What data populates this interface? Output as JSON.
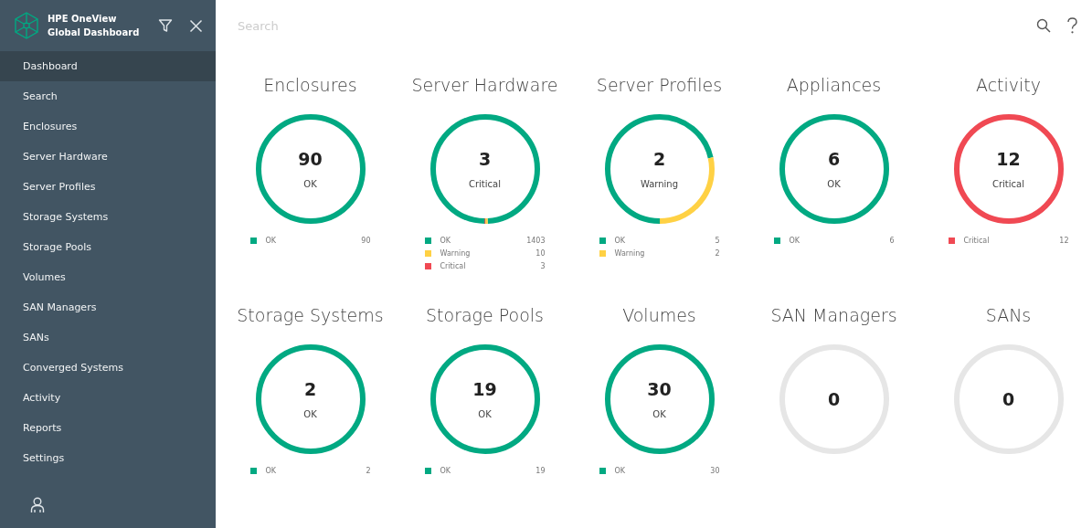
{
  "app": {
    "title_line1": "HPE OneView",
    "title_line2": "Global Dashboard"
  },
  "sidebar": {
    "items": [
      {
        "label": "Dashboard",
        "selected": true
      },
      {
        "label": "Search",
        "selected": false
      },
      {
        "label": "Enclosures",
        "selected": false
      },
      {
        "label": "Server Hardware",
        "selected": false
      },
      {
        "label": "Server Profiles",
        "selected": false
      },
      {
        "label": "Storage Systems",
        "selected": false
      },
      {
        "label": "Storage Pools",
        "selected": false
      },
      {
        "label": "Volumes",
        "selected": false
      },
      {
        "label": "SAN Managers",
        "selected": false
      },
      {
        "label": "SANs",
        "selected": false
      },
      {
        "label": "Converged Systems",
        "selected": false
      },
      {
        "label": "Activity",
        "selected": false
      },
      {
        "label": "Reports",
        "selected": false
      },
      {
        "label": "Settings",
        "selected": false
      }
    ]
  },
  "search": {
    "placeholder": "Search"
  },
  "tiles": [
    {
      "title": "Enclosures",
      "count": "90",
      "status": "OK",
      "legend": [
        {
          "label": "OK",
          "value": "90",
          "color": "#01a982"
        }
      ]
    },
    {
      "title": "Server Hardware",
      "count": "3",
      "status": "Critical",
      "legend": [
        {
          "label": "OK",
          "value": "1403",
          "color": "#01a982"
        },
        {
          "label": "Warning",
          "value": "10",
          "color": "#ffd144"
        },
        {
          "label": "Critical",
          "value": "3",
          "color": "#f04953"
        }
      ]
    },
    {
      "title": "Server Profiles",
      "count": "2",
      "status": "Warning",
      "legend": [
        {
          "label": "OK",
          "value": "5",
          "color": "#01a982"
        },
        {
          "label": "Warning",
          "value": "2",
          "color": "#ffd144"
        }
      ]
    },
    {
      "title": "Appliances",
      "count": "6",
      "status": "OK",
      "legend": [
        {
          "label": "OK",
          "value": "6",
          "color": "#01a982"
        }
      ]
    },
    {
      "title": "Activity",
      "count": "12",
      "status": "Critical",
      "legend": [
        {
          "label": "Critical",
          "value": "12",
          "color": "#f04953"
        }
      ]
    },
    {
      "title": "Storage Systems",
      "count": "2",
      "status": "OK",
      "legend": [
        {
          "label": "OK",
          "value": "2",
          "color": "#01a982"
        }
      ]
    },
    {
      "title": "Storage Pools",
      "count": "19",
      "status": "OK",
      "legend": [
        {
          "label": "OK",
          "value": "19",
          "color": "#01a982"
        }
      ]
    },
    {
      "title": "Volumes",
      "count": "30",
      "status": "OK",
      "legend": [
        {
          "label": "OK",
          "value": "30",
          "color": "#01a982"
        }
      ]
    },
    {
      "title": "SAN Managers",
      "count": "0"
    },
    {
      "title": "SANs",
      "count": "0"
    }
  ]
}
